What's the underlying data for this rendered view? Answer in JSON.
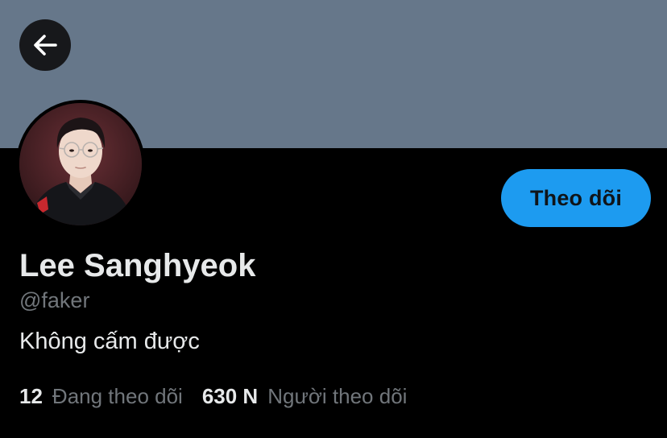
{
  "profile": {
    "display_name": "Lee Sanghyeok",
    "handle": "@faker",
    "bio": "Không cấm được",
    "follow_button_label": "Theo dõi"
  },
  "stats": {
    "following_count": "12",
    "following_label": "Đang theo dõi",
    "followers_count": "630 N",
    "followers_label": "Người theo dõi"
  },
  "icons": {
    "back": "arrow-left-icon"
  },
  "colors": {
    "banner": "#66778a",
    "background": "#000000",
    "accent": "#1d9bf0",
    "primary_text": "#e7e9ea",
    "secondary_text": "#71767b"
  }
}
